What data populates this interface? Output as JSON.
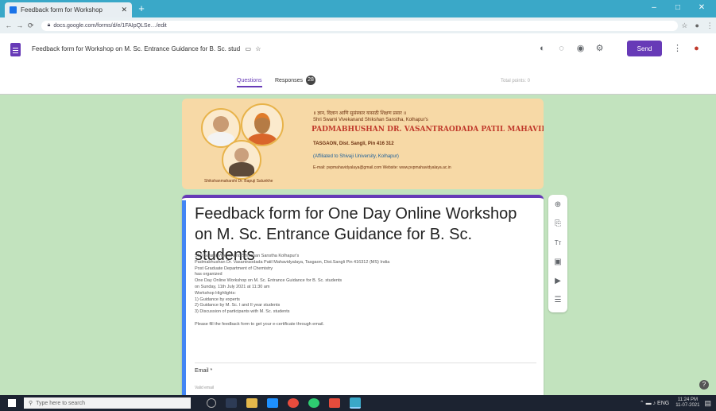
{
  "browser": {
    "tab_title": "Feedback form for Workshop",
    "new_tab": "+",
    "url": "docs.google.com/forms/d/e/1FAIpQLSe…/edit",
    "window_controls": {
      "minimize": "–",
      "maximize": "□",
      "close": "✕"
    }
  },
  "forms_header": {
    "title": "Feedback form for Workshop on M. Sc. Entrance Guidance for B. Sc. stud",
    "send_label": "Send",
    "tabs": {
      "questions": "Questions",
      "responses": "Responses",
      "responses_count": "28"
    },
    "total_points": "Total points: 0"
  },
  "banner": {
    "line1": "॥ ज्ञान, विज्ञान आणि सुसंस्कार यासाठी शिक्षण प्रसार ॥",
    "line2": "Shri Swami Vivekanand Shikshan Sanstha, Kolhapur's",
    "heading": "PADMABHUSHAN DR. VASANTRAODADA PATIL MAHAVIDYALAYA",
    "line3": "TASGAON, Dist. Sangli, Pin 416 312",
    "line4": "(Affiliated to Shivaji University, Kolhapur)",
    "line5": "E-mail: pvpmahavidyalaya@gmail.com  Website: www.pvpmahavidyalaya.ac.in",
    "founder": "Shikshanmaharshi Dr. Bapuji Salunkhe"
  },
  "form": {
    "title": "Feedback form for One Day Online Workshop on M. Sc. Entrance Guidance for B. Sc. students",
    "description": "Shri Swami Vivekanand Shikshan Sanstha Kolhapur's\nPadmabhushan Dr. Vasantraodada Patil Mahavidyalaya, Tasgaon, Dist.Sangli Pin 416312 (MS) India\nPost Graduate Department of Chemistry\nhas organized\nOne Day Online Workshop on M. Sc. Entrance Guidance for B. Sc. students\non Sunday, 11th July 2021 at 11:30 am\nWorkshop Highlights:\n1) Guidance by experts\n2) Guidance by M. Sc. I and II year students\n3) Discussion of participants with M. Sc. students\n\nPlease fill the feedback form to get your e-certificate through email.",
    "email_label": "Email *",
    "email_hint": "Valid email"
  },
  "sidebar": {
    "add_question": "⊕",
    "import": "⎘",
    "title": "Tт",
    "image": "▣",
    "video": "▶",
    "section": "☰"
  },
  "taskbar": {
    "search_placeholder": "Type here to search",
    "time": "11:24 PM",
    "date": "11-07-2021"
  },
  "colors": {
    "accent": "#673ab7",
    "background": "#c2e3be",
    "chrome": "#3aa8c8"
  }
}
